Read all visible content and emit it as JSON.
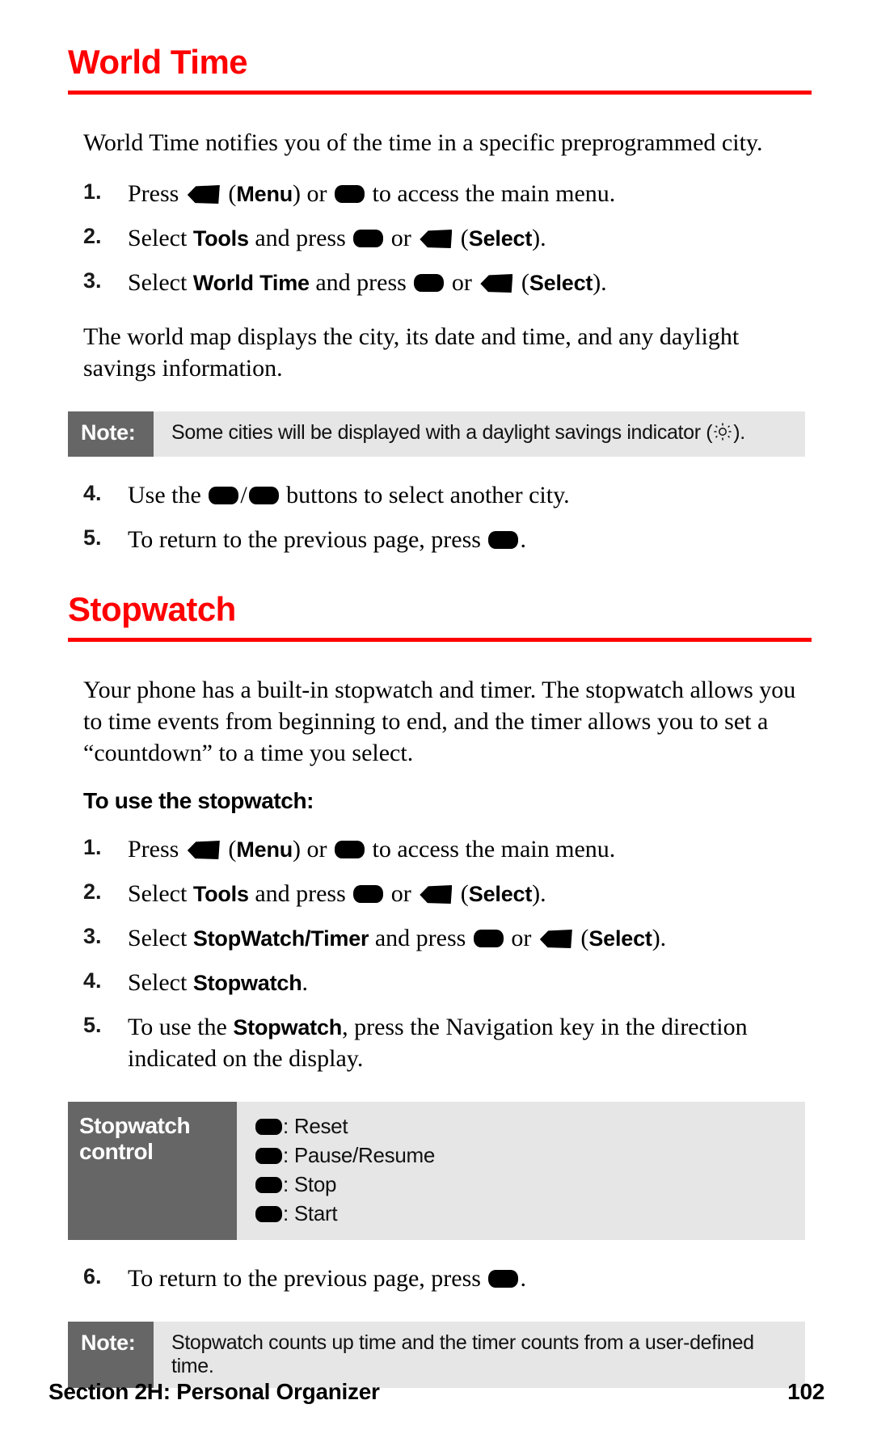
{
  "page": {
    "number": "102",
    "footer_section": "Section 2H: Personal Organizer",
    "accent_color": "#FF0000",
    "note_label_bg": "#666666",
    "note_body_bg": "#E6E6E6"
  },
  "sections": [
    {
      "heading": "World Time",
      "intro": "World Time notifies you of the time in a specific preprogrammed city.",
      "steps_a": [
        {
          "num": "1.",
          "pre": "Press ",
          "icon1": "softkey-left-icon",
          "mid1": " (",
          "bold1": "Menu",
          "mid2": ") or ",
          "icon2": "key-pill-icon",
          "post": " to access the main menu."
        },
        {
          "num": "2.",
          "pre": "Select ",
          "bold1": "Tools",
          "mid1": " and press ",
          "icon1": "key-pill-icon",
          "mid2": " or ",
          "icon2": "softkey-left-icon",
          "mid3": " (",
          "bold2": "Select",
          "post": ")."
        },
        {
          "num": "3.",
          "pre": "Select ",
          "bold1": "World Time",
          "mid1": " and press ",
          "icon1": "key-pill-icon",
          "mid2": " or ",
          "icon2": "softkey-left-icon",
          "mid3": " (",
          "bold2": "Select",
          "post": ")."
        }
      ],
      "outro": "The world map displays the city, its date and time, and any daylight savings information.",
      "note": {
        "label": "Note:",
        "text_pre": "Some cities will be displayed with a daylight savings indicator (",
        "icon": "sun-icon",
        "text_post": ")."
      },
      "steps_b": [
        {
          "num": "4.",
          "pre": "Use the ",
          "icon1": "key-pill-icon",
          "mid1": "/",
          "icon2": "key-pill-icon",
          "post": " buttons to select another city."
        },
        {
          "num": "5.",
          "pre": "To return to the previous page, press ",
          "icon1": "key-pill-icon",
          "post": "."
        }
      ]
    },
    {
      "heading": "Stopwatch",
      "intro": "Your phone has a built-in stopwatch and timer. The stopwatch allows you to time events from beginning to end, and the timer allows you to set a “countdown” to a time you select.",
      "subhead": "To use the stopwatch:",
      "steps_a": [
        {
          "num": "1.",
          "pre": "Press ",
          "icon1": "softkey-left-icon",
          "mid1": " (",
          "bold1": "Menu",
          "mid2": ") or ",
          "icon2": "key-pill-icon",
          "post": " to access the main menu."
        },
        {
          "num": "2.",
          "pre": "Select ",
          "bold1": "Tools",
          "mid1": " and press ",
          "icon1": "key-pill-icon",
          "mid2": " or ",
          "icon2": "softkey-left-icon",
          "mid3": " (",
          "bold2": "Select",
          "post": ")."
        },
        {
          "num": "3.",
          "pre": "Select ",
          "bold1": "StopWatch/Timer",
          "mid1": " and press ",
          "icon1": "key-pill-icon",
          "mid2": " or ",
          "icon2": "softkey-left-icon",
          "mid3": " (",
          "bold2": "Select",
          "post": ")."
        },
        {
          "num": "4.",
          "pre": "Select ",
          "bold1": "Stopwatch",
          "post": "."
        },
        {
          "num": "5.",
          "pre": "To use the ",
          "bold1": "Stopwatch",
          "post": ", press the Navigation key in the direction indicated on the display."
        }
      ],
      "control_table": {
        "label": "Stopwatch control",
        "rows": [
          {
            "icon": "key-pill-icon",
            "text": ": Reset"
          },
          {
            "icon": "key-pill-icon",
            "text": ": Pause/Resume"
          },
          {
            "icon": "key-pill-icon",
            "text": ": Stop"
          },
          {
            "icon": "key-pill-icon",
            "text": ": Start"
          }
        ]
      },
      "steps_b": [
        {
          "num": "6.",
          "pre": "To return to the previous page, press ",
          "icon1": "key-pill-icon",
          "post": "."
        }
      ],
      "note": {
        "label": "Note:",
        "text_pre": "Stopwatch counts up time and the timer counts from a user-defined time.",
        "text_post": ""
      }
    }
  ]
}
